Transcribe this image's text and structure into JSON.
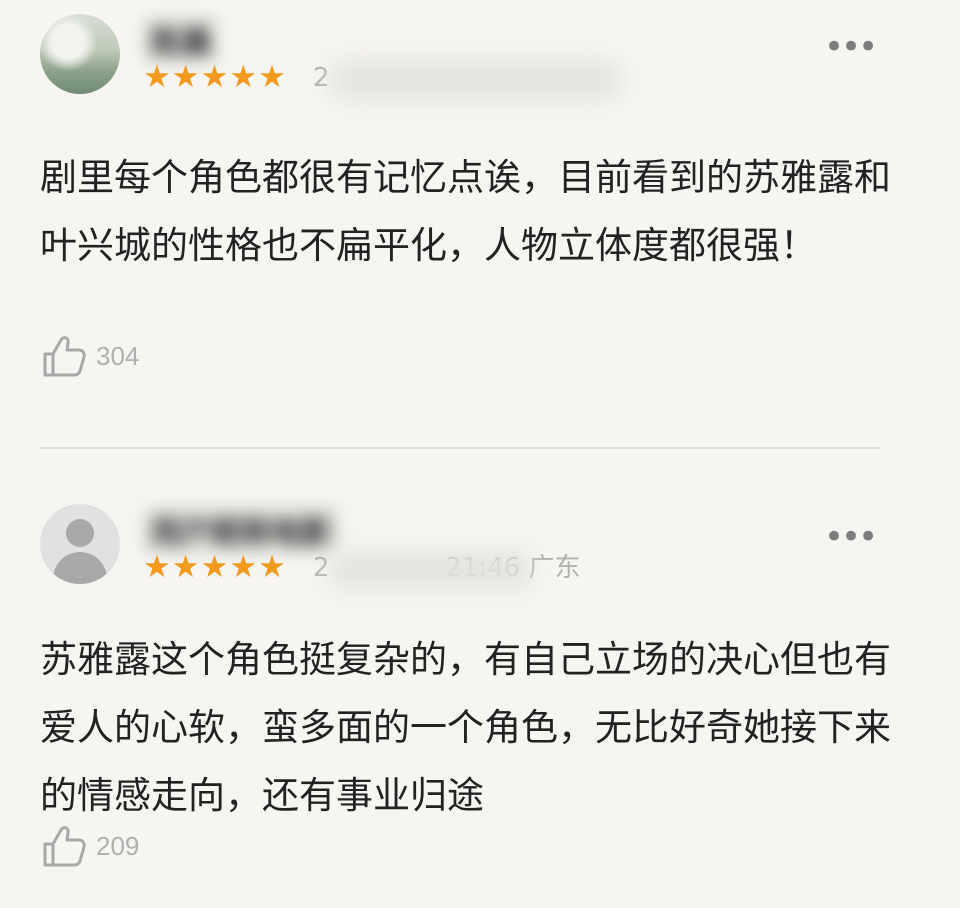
{
  "reviews": [
    {
      "username": "陈晨",
      "rating_stars": "★★★★★",
      "rating": 5,
      "timestamp_visible": "2",
      "text": "剧里每个角色都很有记忆点诶，目前看到的苏雅露和叶兴城的性格也不扁平化，人物立体度都很强！",
      "likes": "304",
      "more_label": "•••",
      "avatar_icon": "landscape-avatar-icon"
    },
    {
      "username": "用户昵称电影",
      "rating_stars": "★★★★★",
      "rating": 5,
      "timestamp_visible": "2              21:46 广东",
      "text": "苏雅露这个角色挺复杂的，有自己立场的决心但也有爱人的心软，蛮多面的一个角色，无比好奇她接下来的情感走向，还有事业归途",
      "likes": "209",
      "more_label": "•••",
      "avatar_icon": "default-user-avatar-icon"
    }
  ],
  "colors": {
    "star": "#f29a1d",
    "background": "#f7f5f1",
    "text": "#222222",
    "muted": "#b0b0b0"
  }
}
